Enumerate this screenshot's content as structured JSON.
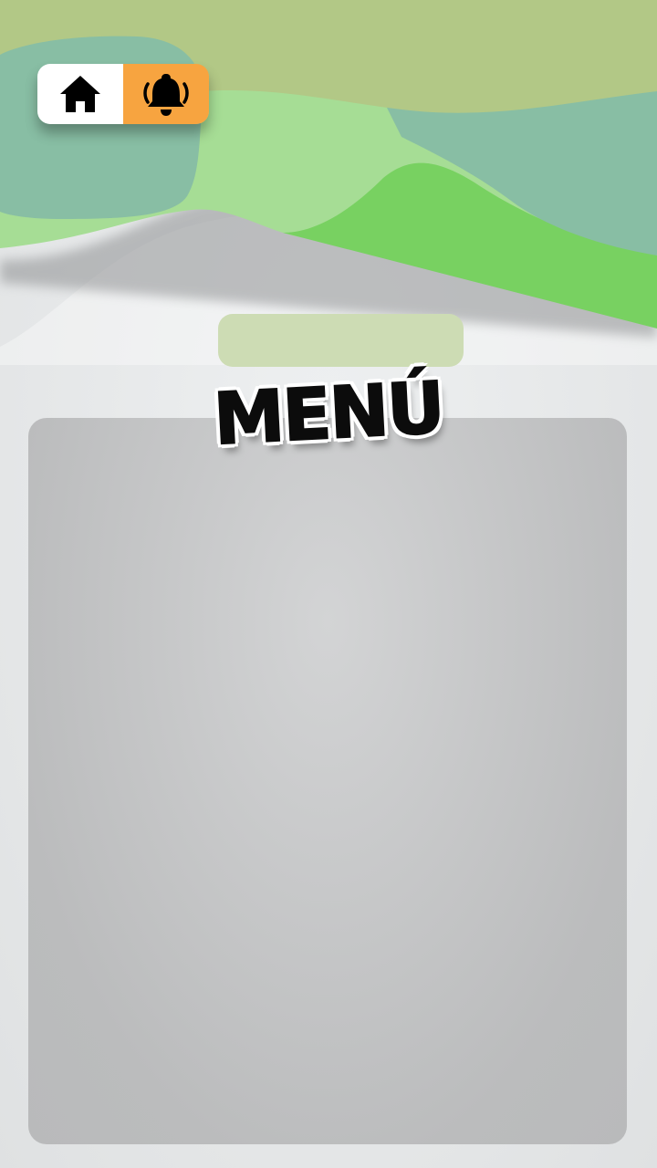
{
  "page": {
    "title": "MENÚ"
  },
  "nav": {
    "items": [
      {
        "icon": "home-icon",
        "active": false
      },
      {
        "icon": "bell-ringing-icon",
        "active": true
      }
    ]
  },
  "colors": {
    "wave_olive": "#b2c886",
    "wave_teal": "#88bea4",
    "wave_light_green": "#a6dd95",
    "wave_bright_green": "#78d161",
    "active_toggle": "#f7a440",
    "pill": "#cddcb4",
    "panel": "#bbbcbd"
  }
}
